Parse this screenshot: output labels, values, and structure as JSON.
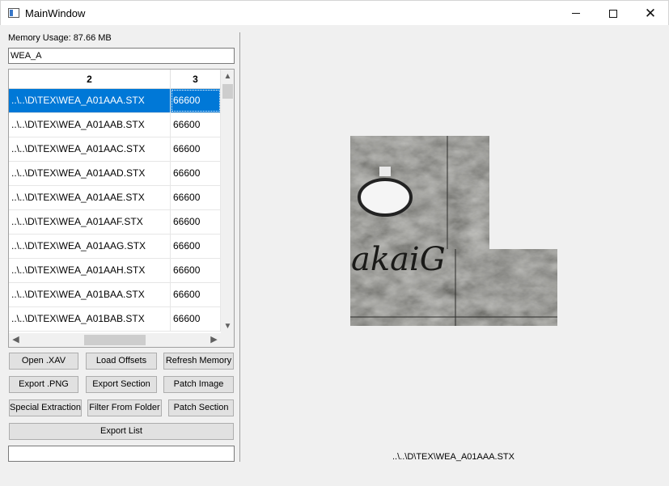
{
  "window": {
    "title": "MainWindow",
    "minimize": "—",
    "maximize": "☐",
    "close": "✕"
  },
  "memory_label": "Memory Usage: 87.66 MB",
  "filter": {
    "value": "WEA_A"
  },
  "table": {
    "headers": [
      "2",
      "3"
    ],
    "rows": [
      {
        "name": "..\\..\\D\\TEX\\WEA_A01AAA.STX",
        "size": "66600"
      },
      {
        "name": "..\\..\\D\\TEX\\WEA_A01AAB.STX",
        "size": "66600"
      },
      {
        "name": "..\\..\\D\\TEX\\WEA_A01AAC.STX",
        "size": "66600"
      },
      {
        "name": "..\\..\\D\\TEX\\WEA_A01AAD.STX",
        "size": "66600"
      },
      {
        "name": "..\\..\\D\\TEX\\WEA_A01AAE.STX",
        "size": "66600"
      },
      {
        "name": "..\\..\\D\\TEX\\WEA_A01AAF.STX",
        "size": "66600"
      },
      {
        "name": "..\\..\\D\\TEX\\WEA_A01AAG.STX",
        "size": "66600"
      },
      {
        "name": "..\\..\\D\\TEX\\WEA_A01AAH.STX",
        "size": "66600"
      },
      {
        "name": "..\\..\\D\\TEX\\WEA_A01BAA.STX",
        "size": "66600"
      },
      {
        "name": "..\\..\\D\\TEX\\WEA_A01BAB.STX",
        "size": "66600"
      }
    ],
    "selected_row": 0
  },
  "buttons": {
    "open_xav": "Open .XAV",
    "load_offsets": "Load Offsets",
    "refresh_memory": "Refresh Memory",
    "export_png": "Export .PNG",
    "export_section": "Export Section",
    "patch_image": "Patch Image",
    "special_extraction": "Special Extraction",
    "filter_from_folder": "Filter From Folder",
    "patch_section": "Patch Section",
    "export_list": "Export List"
  },
  "preview": {
    "path": "..\\..\\D\\TEX\\WEA_A01AAA.STX",
    "logo_text": "akaiG"
  },
  "colors": {
    "selection": "#0078d7",
    "texture_dark": "#3a3a38"
  }
}
